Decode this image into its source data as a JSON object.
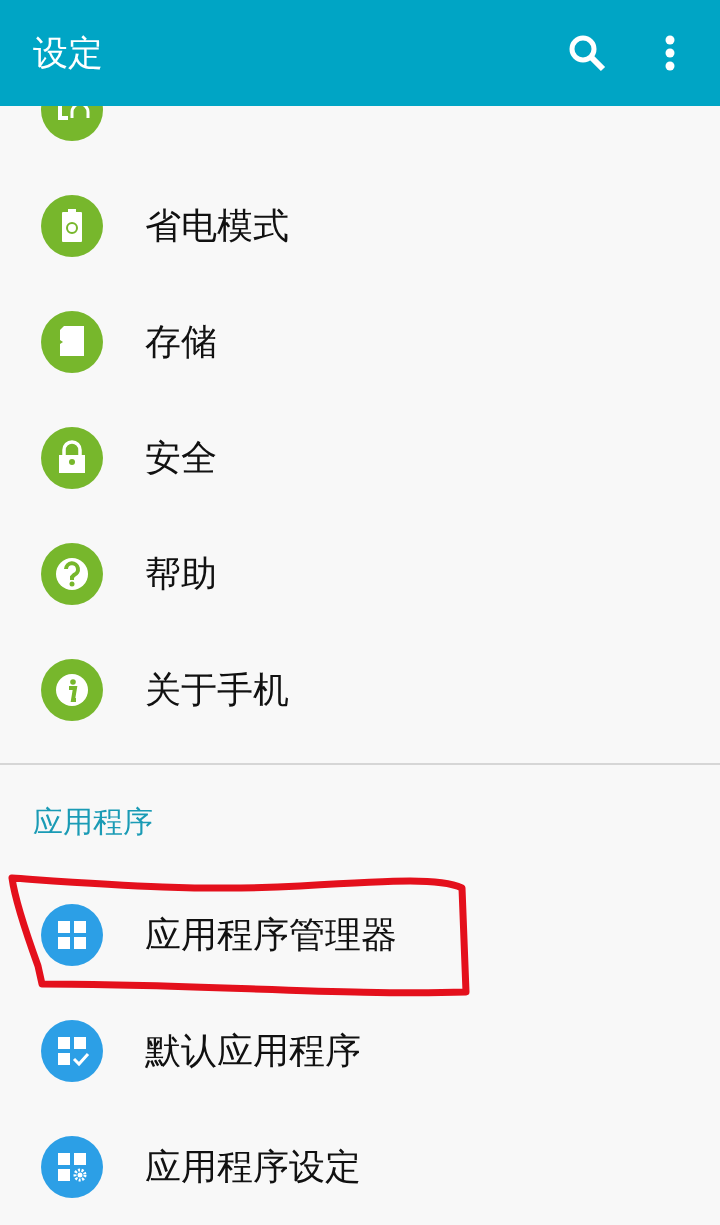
{
  "app_bar": {
    "title": "设定"
  },
  "sections": [
    {
      "items": [
        {
          "kind": "accessories",
          "color": "#77b72c"
        },
        {
          "label": "省电模式",
          "kind": "battery",
          "color": "#77b72c"
        },
        {
          "label": "存储",
          "kind": "storage",
          "color": "#77b72c"
        },
        {
          "label": "安全",
          "kind": "lock",
          "color": "#77b72c"
        },
        {
          "label": "帮助",
          "kind": "help",
          "color": "#77b72c"
        },
        {
          "label": "关于手机",
          "kind": "info",
          "color": "#77b72c"
        }
      ]
    },
    {
      "title": "应用程序",
      "items": [
        {
          "label": "应用程序管理器",
          "kind": "apps",
          "color": "#2c9fe6"
        },
        {
          "label": "默认应用程序",
          "kind": "default-apps",
          "color": "#2c9fe6"
        },
        {
          "label": "应用程序设定",
          "kind": "app-settings",
          "color": "#2c9fe6"
        }
      ]
    }
  ]
}
